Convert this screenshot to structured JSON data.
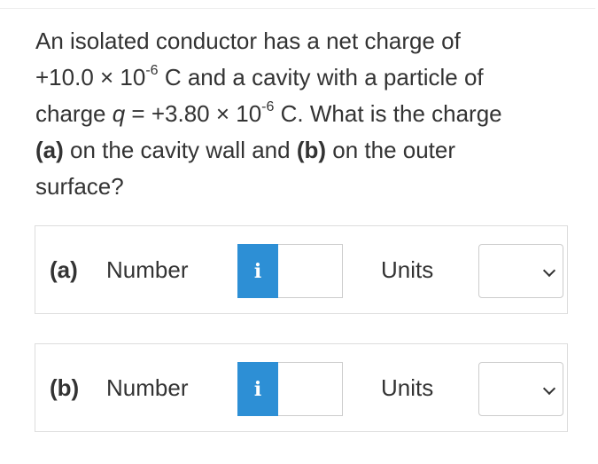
{
  "question": {
    "line1": "An isolated conductor has a net charge of",
    "charge_value": "+10.0 × 10",
    "charge_exp": "-6",
    "line2_rest": "C and a cavity with a particle of",
    "line3_pre": "charge ",
    "q_symbol": "q",
    "line3_eq": " = +3.80 × 10",
    "q_exp": "-6",
    "line3_rest": " C. What is the charge",
    "part_a_marker": "(a)",
    "part_a_text": " on the cavity wall and ",
    "part_b_marker": "(b)",
    "part_b_text": " on the outer",
    "line5": "surface?"
  },
  "answers": [
    {
      "part": "(a)",
      "number_label": "Number",
      "info_icon": "i",
      "number_value": "",
      "units_label": "Units",
      "units_value": ""
    },
    {
      "part": "(b)",
      "number_label": "Number",
      "info_icon": "i",
      "number_value": "",
      "units_label": "Units",
      "units_value": ""
    }
  ],
  "colors": {
    "info_button": "#2d8fd5",
    "text": "#333333",
    "border": "#dddddd"
  },
  "icons": {
    "info": "info-icon",
    "dropdown": "chevron-down-icon"
  }
}
